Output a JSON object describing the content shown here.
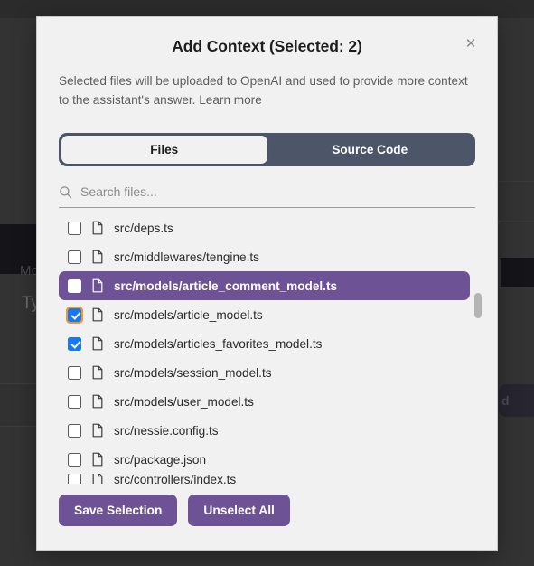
{
  "background": {
    "label_mo": "Mo",
    "label_ty": "Ty",
    "glyph_left": "{",
    "glyph_right": "d",
    "chevron": "⌄"
  },
  "modal": {
    "title": "Add Context (Selected: 2)",
    "close_label": "✕",
    "description": "Selected files will be uploaded to OpenAI and used to provide more context to the assistant's answer. ",
    "learn_more": "Learn more",
    "tabs": [
      {
        "label": "Files",
        "active": true
      },
      {
        "label": "Source Code",
        "active": false
      }
    ],
    "search": {
      "placeholder": "Search files...",
      "value": "",
      "icon": "search-icon"
    },
    "files": [
      {
        "name": "src/deps.ts",
        "checked": false,
        "highlighted": false,
        "focused": false
      },
      {
        "name": "src/middlewares/tengine.ts",
        "checked": false,
        "highlighted": false,
        "focused": false
      },
      {
        "name": "src/models/article_comment_model.ts",
        "checked": false,
        "highlighted": true,
        "focused": false
      },
      {
        "name": "src/models/article_model.ts",
        "checked": true,
        "highlighted": false,
        "focused": true
      },
      {
        "name": "src/models/articles_favorites_model.ts",
        "checked": true,
        "highlighted": false,
        "focused": false
      },
      {
        "name": "src/models/session_model.ts",
        "checked": false,
        "highlighted": false,
        "focused": false
      },
      {
        "name": "src/models/user_model.ts",
        "checked": false,
        "highlighted": false,
        "focused": false
      },
      {
        "name": "src/nessie.config.ts",
        "checked": false,
        "highlighted": false,
        "focused": false
      },
      {
        "name": "src/package.json",
        "checked": false,
        "highlighted": false,
        "focused": false
      },
      {
        "name": "src/controllers/index.ts",
        "checked": false,
        "highlighted": false,
        "focused": false
      }
    ],
    "footer": {
      "save_label": "Save Selection",
      "unselect_label": "Unselect All"
    }
  },
  "colors": {
    "accent_purple": "#6d5296",
    "tab_bar_slate": "#4d5568",
    "checkbox_blue": "#1877f2",
    "focus_orange": "#f0962b",
    "modal_bg": "#f1f1f1",
    "app_bg": "#333333"
  }
}
